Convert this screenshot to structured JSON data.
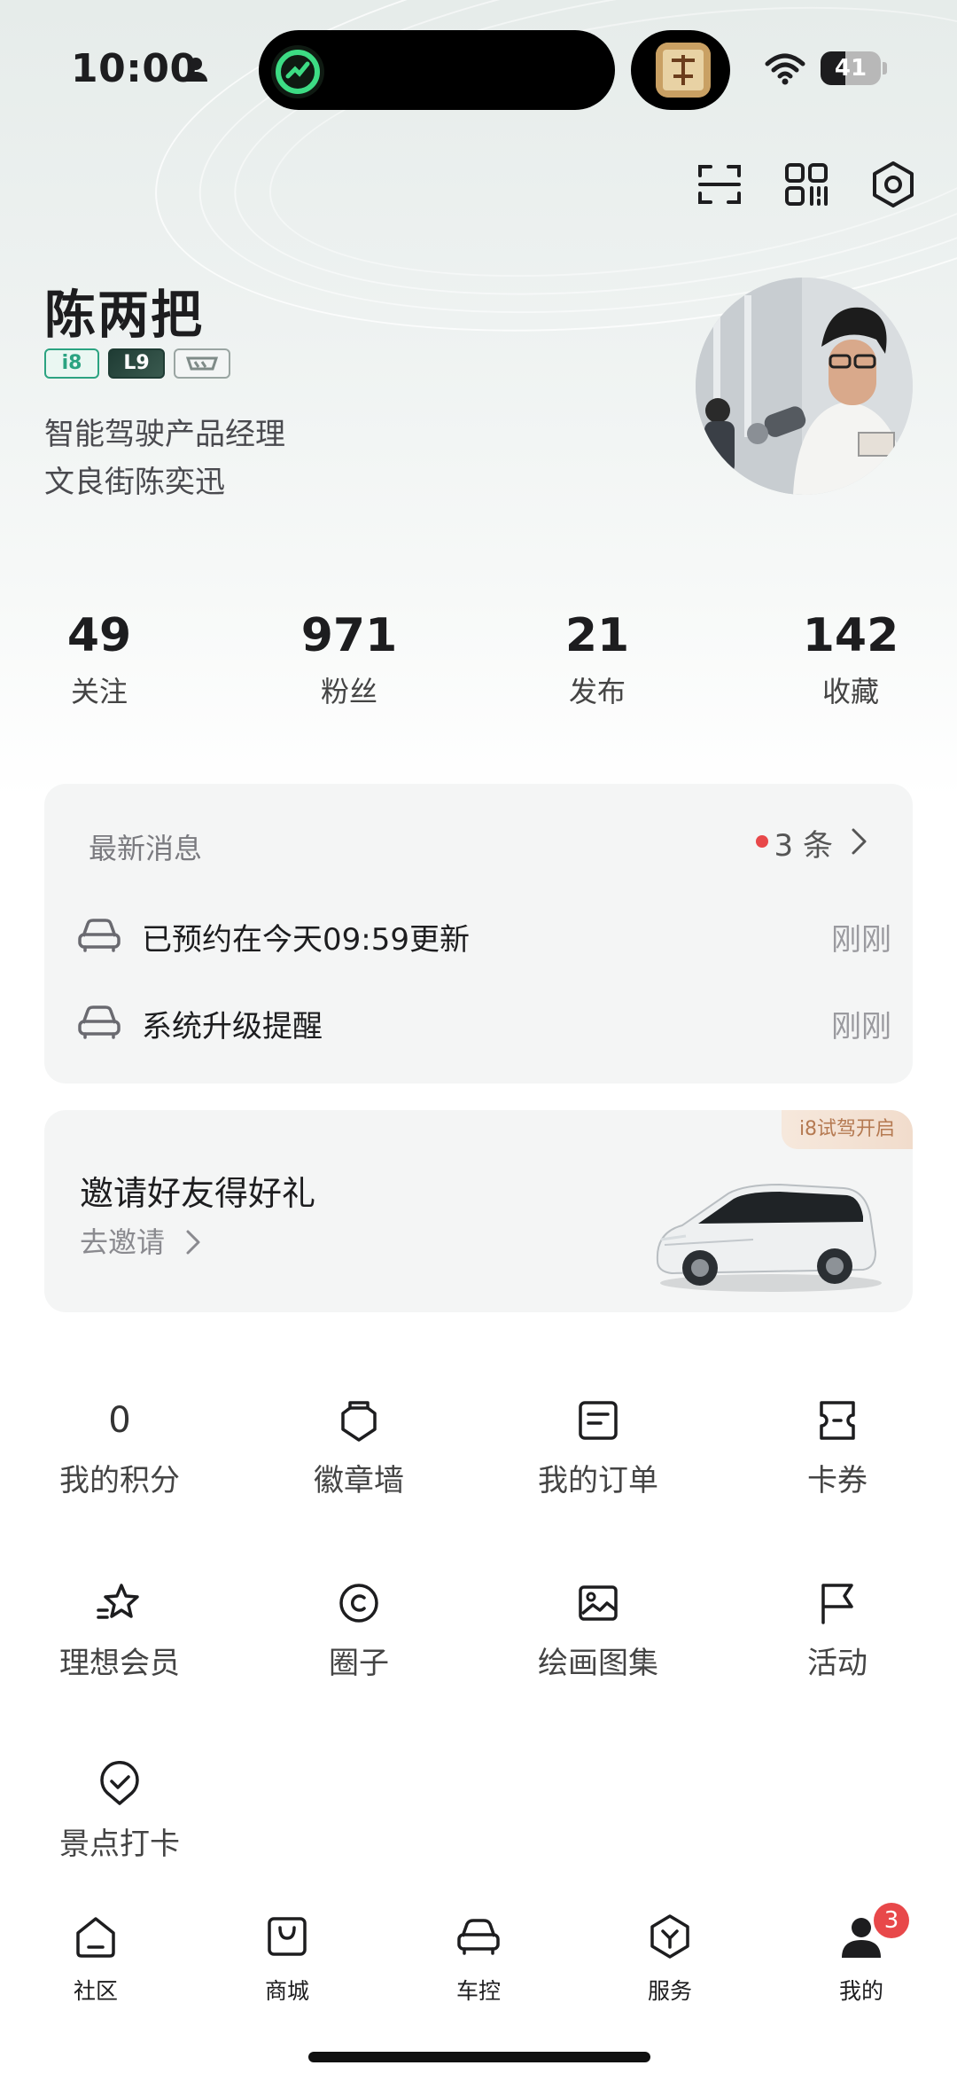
{
  "status_bar": {
    "time": "10:00",
    "battery_level": "41",
    "battery_fraction": 0.41
  },
  "profile": {
    "name": "陈两把",
    "badges": [
      "i8",
      "L9"
    ],
    "subtitle_line1": "智能驾驶产品经理",
    "subtitle_line2": "文良街陈奕迅"
  },
  "stats": [
    {
      "value": "49",
      "label": "关注"
    },
    {
      "value": "971",
      "label": "粉丝"
    },
    {
      "value": "21",
      "label": "发布"
    },
    {
      "value": "142",
      "label": "收藏"
    }
  ],
  "messages": {
    "title": "最新消息",
    "count": "3 条",
    "items": [
      {
        "text": "已预约在今天09:59更新",
        "time": "刚刚"
      },
      {
        "text": "系统升级提醒",
        "time": "刚刚"
      }
    ]
  },
  "invite": {
    "title": "邀请好友得好礼",
    "link": "去邀请",
    "tag": "i8试驾开启"
  },
  "grid": [
    {
      "label": "我的积分",
      "value": "0",
      "icon": "points-icon"
    },
    {
      "label": "徽章墙",
      "icon": "badge-icon"
    },
    {
      "label": "我的订单",
      "icon": "order-icon"
    },
    {
      "label": "卡券",
      "icon": "coupon-icon"
    },
    {
      "label": "理想会员",
      "icon": "star-icon"
    },
    {
      "label": "圈子",
      "icon": "circle-icon"
    },
    {
      "label": "绘画图集",
      "icon": "image-icon"
    },
    {
      "label": "活动",
      "icon": "flag-icon"
    },
    {
      "label": "景点打卡",
      "icon": "checkin-icon"
    }
  ],
  "tabs": [
    {
      "label": "社区",
      "icon": "home-icon"
    },
    {
      "label": "商城",
      "icon": "shop-icon"
    },
    {
      "label": "车控",
      "icon": "car-icon"
    },
    {
      "label": "服务",
      "icon": "service-icon"
    },
    {
      "label": "我的",
      "icon": "profile-icon",
      "badge": "3"
    }
  ],
  "colors": {
    "accent_green": "#2ba381",
    "badge_red": "#e8484a",
    "card_bg": "#f4f5f5"
  }
}
